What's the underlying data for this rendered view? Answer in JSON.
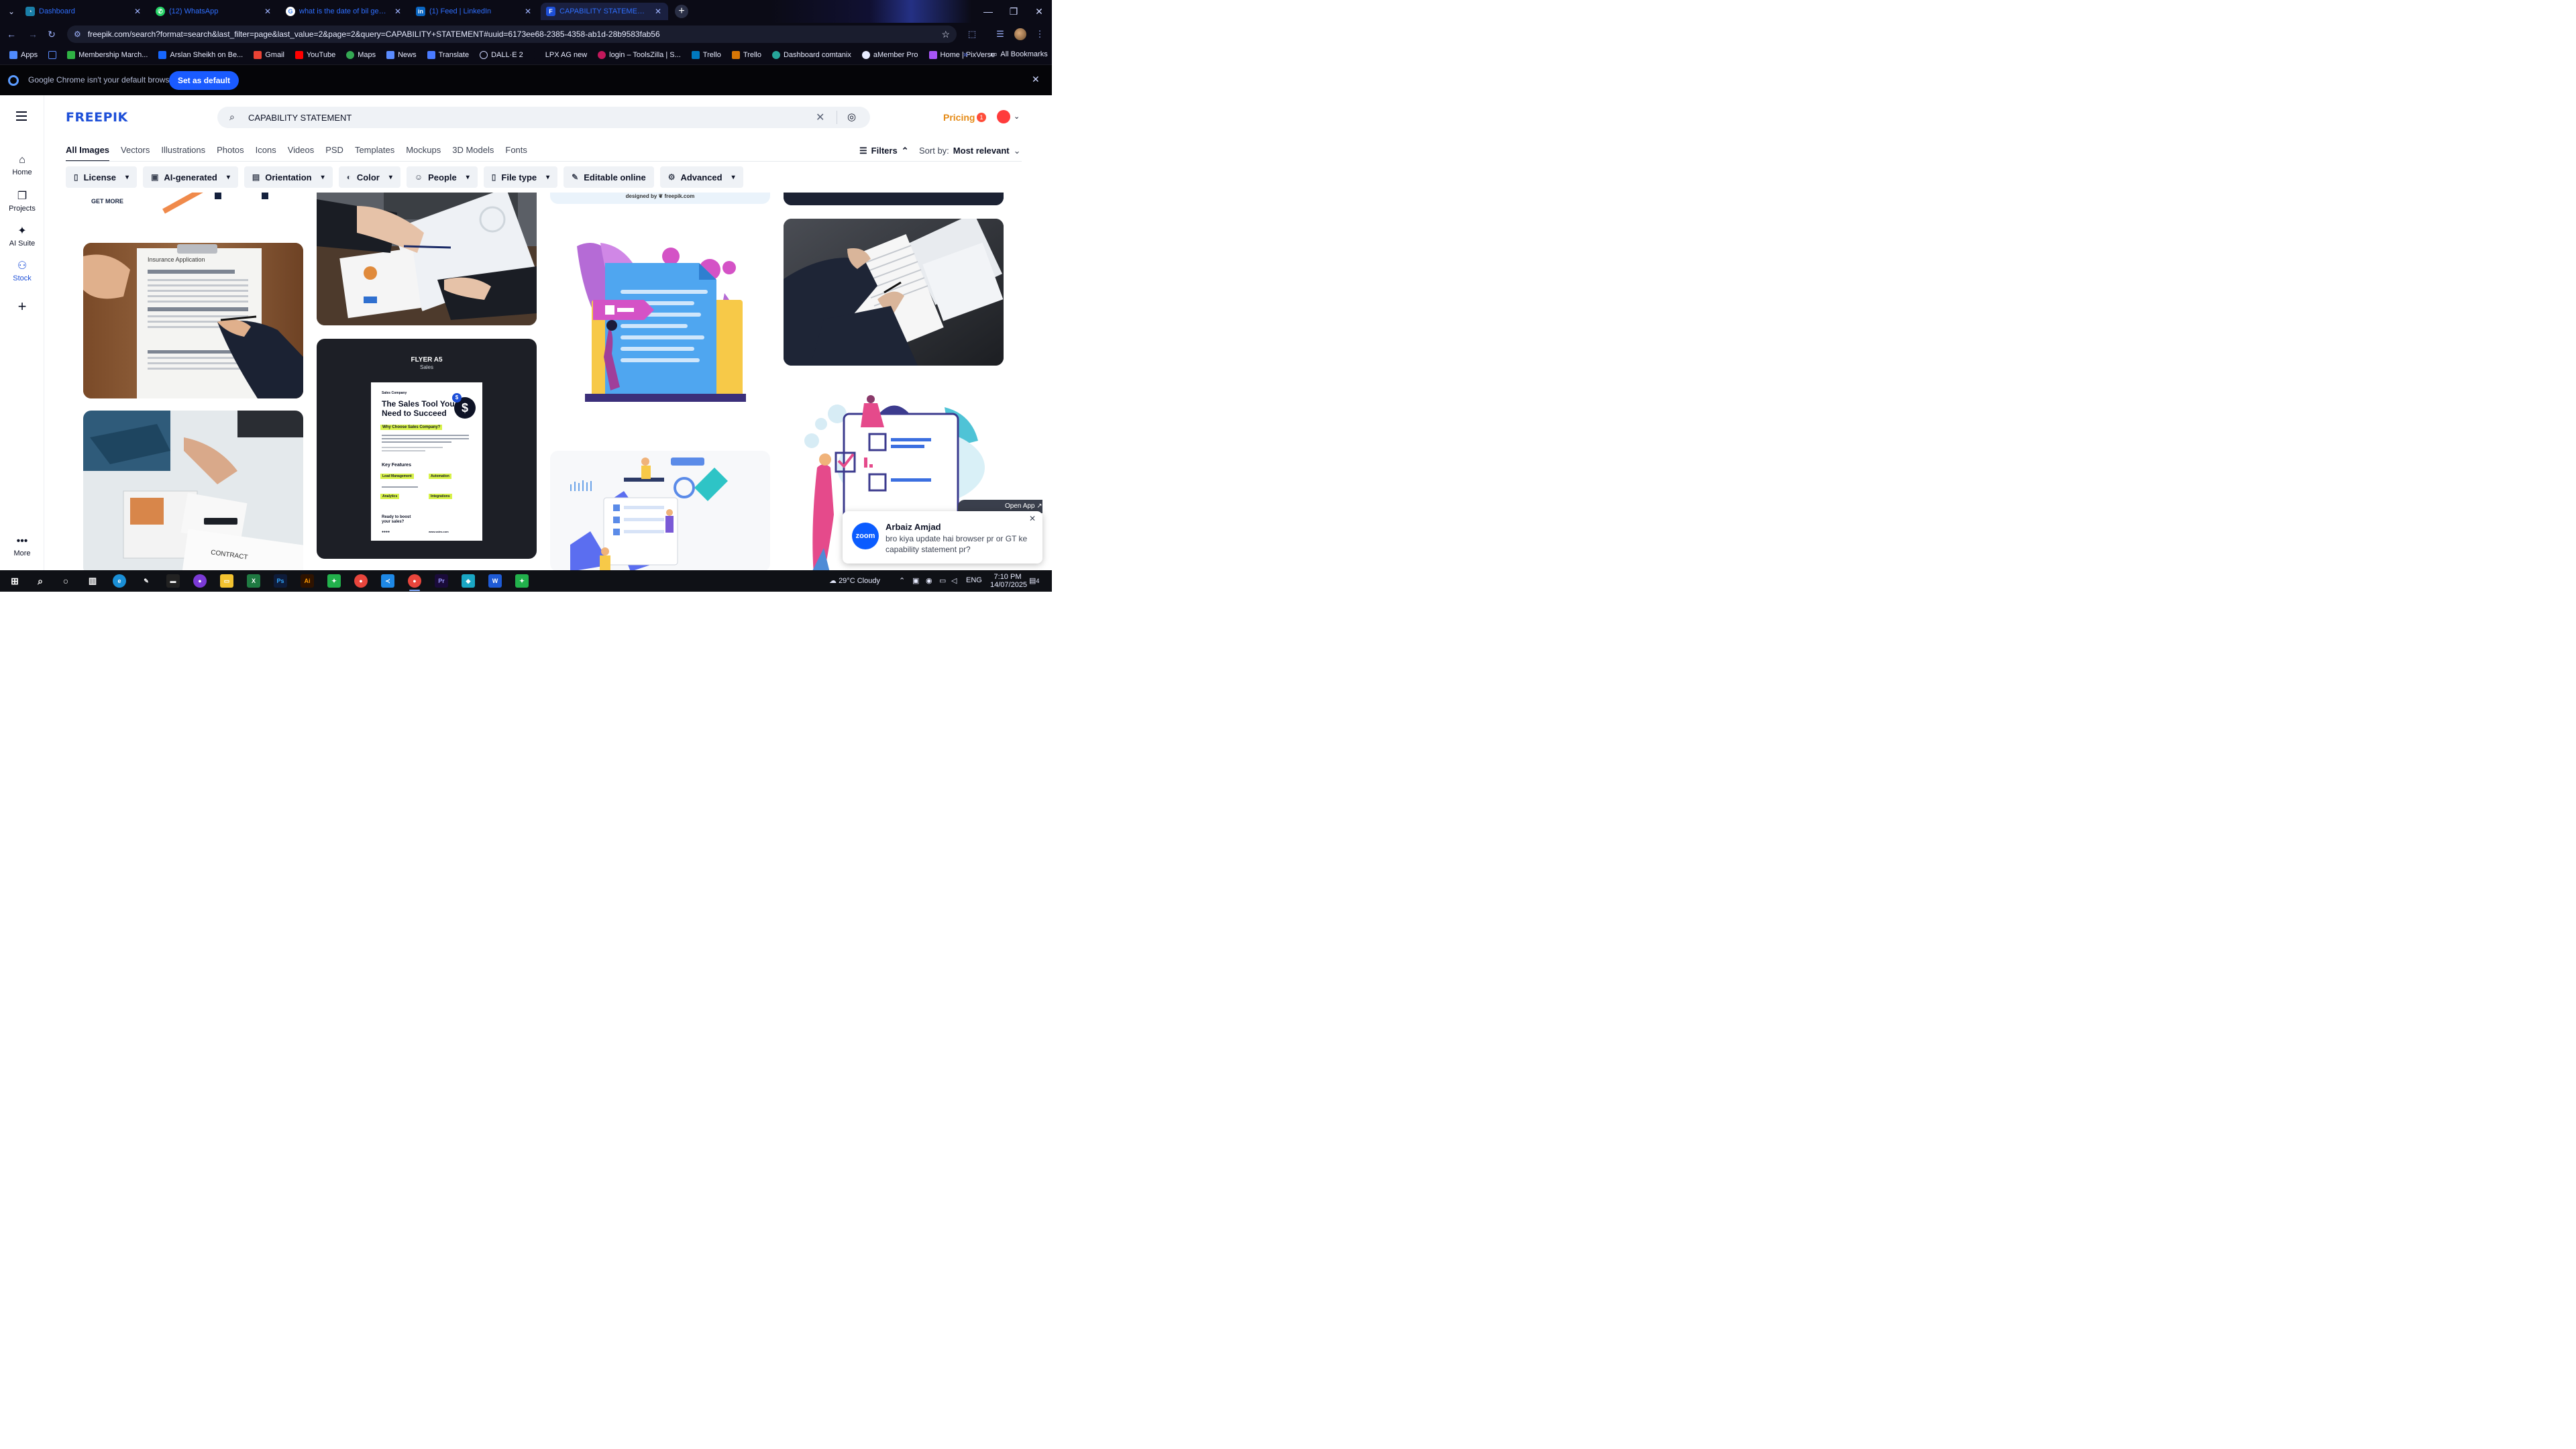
{
  "browser": {
    "tabs": [
      {
        "title": "Dashboard",
        "active": false,
        "favicon_color": "#1a7fa8"
      },
      {
        "title": "(12) WhatsApp",
        "active": false,
        "favicon_color": "#25d366"
      },
      {
        "title": "what is the date of bil generatio",
        "active": false,
        "favicon_color": "#ffffff"
      },
      {
        "title": "(1) Feed | LinkedIn",
        "active": false,
        "favicon_color": "#0a66c2"
      },
      {
        "title": "CAPABILITY STATEMENT vecto",
        "active": true,
        "favicon_color": "#1d4fd8"
      }
    ],
    "url": "freepik.com/search?format=search&last_filter=page&last_value=2&page=2&query=CAPABILITY+STATEMENT#uuid=6173ee68-2385-4358-ab1d-28b9583fab56",
    "bookmarks": [
      {
        "label": "Apps",
        "color": "#4f8bff"
      },
      {
        "label": "Membership March...",
        "color": "#2fb344"
      },
      {
        "label": "Arslan Sheikh on Be...",
        "color": "#1767ff"
      },
      {
        "label": "Gmail",
        "color": "#ea4335"
      },
      {
        "label": "YouTube",
        "color": "#ff0000"
      },
      {
        "label": "Maps",
        "color": "#34a853"
      },
      {
        "label": "News",
        "color": "#5b8cff"
      },
      {
        "label": "Translate",
        "color": "#4a7bff"
      },
      {
        "label": "DALL·E 2",
        "color": "#cfd8ff"
      },
      {
        "label": "LPX AG new",
        "color": "#0b0b16"
      },
      {
        "label": "login – ToolsZilla | S...",
        "color": "#c2185b"
      },
      {
        "label": "Trello",
        "color": "#0079bf"
      },
      {
        "label": "Trello",
        "color": "#d97706"
      },
      {
        "label": "Dashboard comtanix",
        "color": "#26a69a"
      },
      {
        "label": "aMember Pro",
        "color": "#e8ecff"
      },
      {
        "label": "Home | PixVerse",
        "color": "#a855f7"
      }
    ],
    "all_bookmarks": "All Bookmarks",
    "infobar": {
      "message": "Google Chrome isn't your default browser",
      "button": "Set as default"
    }
  },
  "site": {
    "logo": "FREEPIK",
    "search_value": "CAPABILITY STATEMENT",
    "pricing": "Pricing",
    "notif_count": "1",
    "rail": [
      {
        "label": "Home",
        "icon": "home-icon"
      },
      {
        "label": "Projects",
        "icon": "projects-icon"
      },
      {
        "label": "AI Suite",
        "icon": "sparkle-icon"
      },
      {
        "label": "Stock",
        "icon": "stock-icon"
      },
      {
        "label": "More",
        "icon": "more-icon"
      }
    ],
    "categories": [
      "All Images",
      "Vectors",
      "Illustrations",
      "Photos",
      "Icons",
      "Videos",
      "PSD",
      "Templates",
      "Mockups",
      "3D Models",
      "Fonts"
    ],
    "filters_label": "Filters",
    "sort_label": "Sort by:",
    "sort_value": "Most relevant",
    "chips": [
      {
        "label": "License",
        "icon": "license-icon",
        "dropdown": true
      },
      {
        "label": "AI-generated",
        "icon": "ai-icon",
        "dropdown": true
      },
      {
        "label": "Orientation",
        "icon": "orientation-icon",
        "dropdown": true
      },
      {
        "label": "Color",
        "icon": "palette-icon",
        "dropdown": true
      },
      {
        "label": "People",
        "icon": "people-icon",
        "dropdown": true
      },
      {
        "label": "File type",
        "icon": "file-icon",
        "dropdown": true
      },
      {
        "label": "Editable online",
        "icon": "pen-icon",
        "dropdown": false
      },
      {
        "label": "Advanced",
        "icon": "gear-icon",
        "dropdown": true
      }
    ]
  },
  "results": {
    "get_more": "GET MORE",
    "designed_by": "designed by ❦ freepik.com",
    "insurance_title": "Insurance Application",
    "contract_label": "CONTRACT",
    "flyer": {
      "heading": "FLYER A5",
      "sub": "Sales",
      "company": "Sales Company",
      "headline1": "The Sales Tool You",
      "headline2": "Need to Succeed",
      "why": "Why Choose Sales Company?",
      "features": "Key Features",
      "f1": "Lead Management",
      "f2": "Automation",
      "f3": "Analytics",
      "f4": "Integrations",
      "ready1": "Ready to boost",
      "ready2": "your sales?",
      "site": "www.sales.com"
    }
  },
  "toast": {
    "open_app": "Open App ↗",
    "app": "zoom",
    "sender": "Arbaiz Amjad",
    "message": "bro kiya update hai browser pr or GT ke capability statement pr?"
  },
  "taskbar": {
    "weather": "29°C  Cloudy",
    "lang": "ENG",
    "time": "7:10 PM",
    "date": "14/07/2025",
    "notif": "4"
  }
}
